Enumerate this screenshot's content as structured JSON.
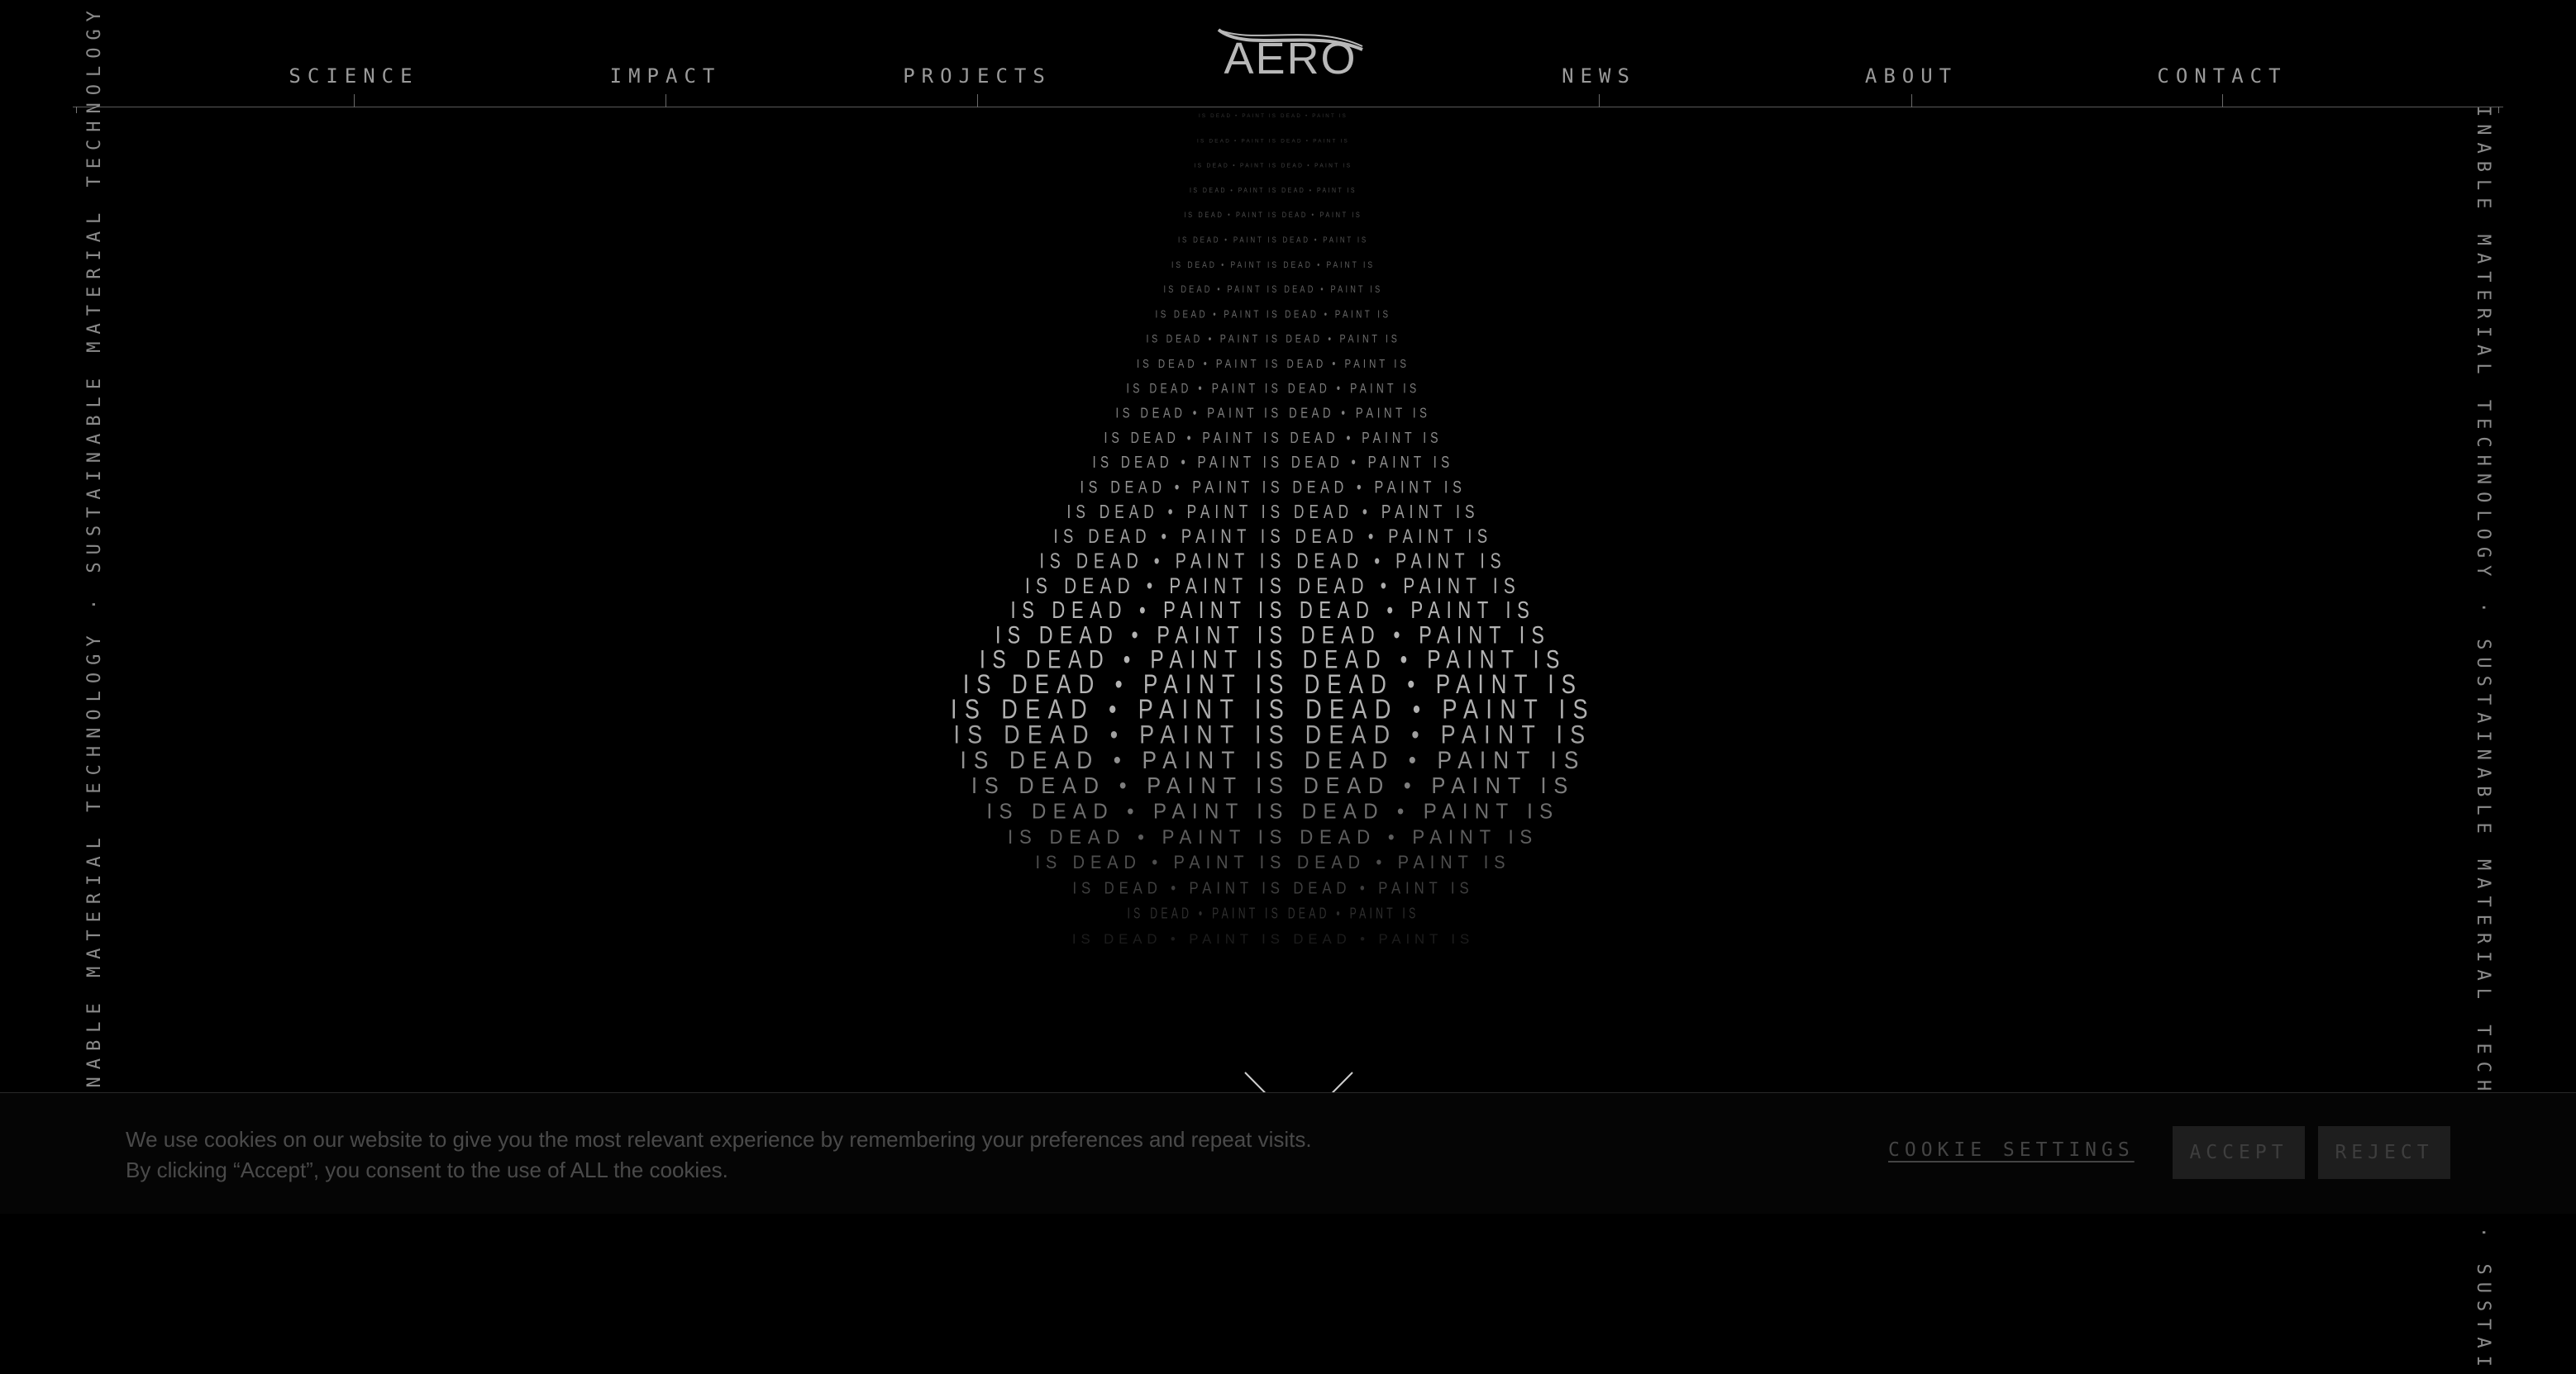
{
  "nav": {
    "left": [
      {
        "label": "SCIENCE"
      },
      {
        "label": "IMPACT"
      },
      {
        "label": "PROJECTS"
      }
    ],
    "right": [
      {
        "label": "NEWS"
      },
      {
        "label": "ABOUT"
      },
      {
        "label": "CONTACT"
      }
    ]
  },
  "logo": {
    "text": "AERO"
  },
  "side": {
    "left_text": "SUSTAINABLE MATERIAL TECHNOLOGY · SUSTAINABLE MATERIAL TECHNOLOGY ·",
    "right_text": "INABLE MATERIAL TECHNOLOGY · SUSTAINABLE MATERIAL TECHNOLOGY · SUSTAI"
  },
  "hero": {
    "phrase": "PAINT IS DEAD",
    "separator": "•"
  },
  "icons": {
    "scroll": "chevron-down-icon"
  },
  "cookie": {
    "line1": "We use cookies on our website to give you the most relevant experience by remembering your preferences and repeat visits.",
    "line2": "By clicking “Accept”, you consent to the use of ALL the cookies.",
    "settings_label": "COOKIE SETTINGS",
    "accept_label": "ACCEPT",
    "reject_label": "REJECT"
  },
  "colors": {
    "background": "#000000",
    "text": "#9a9a9a",
    "rule": "#5a5a5a"
  }
}
